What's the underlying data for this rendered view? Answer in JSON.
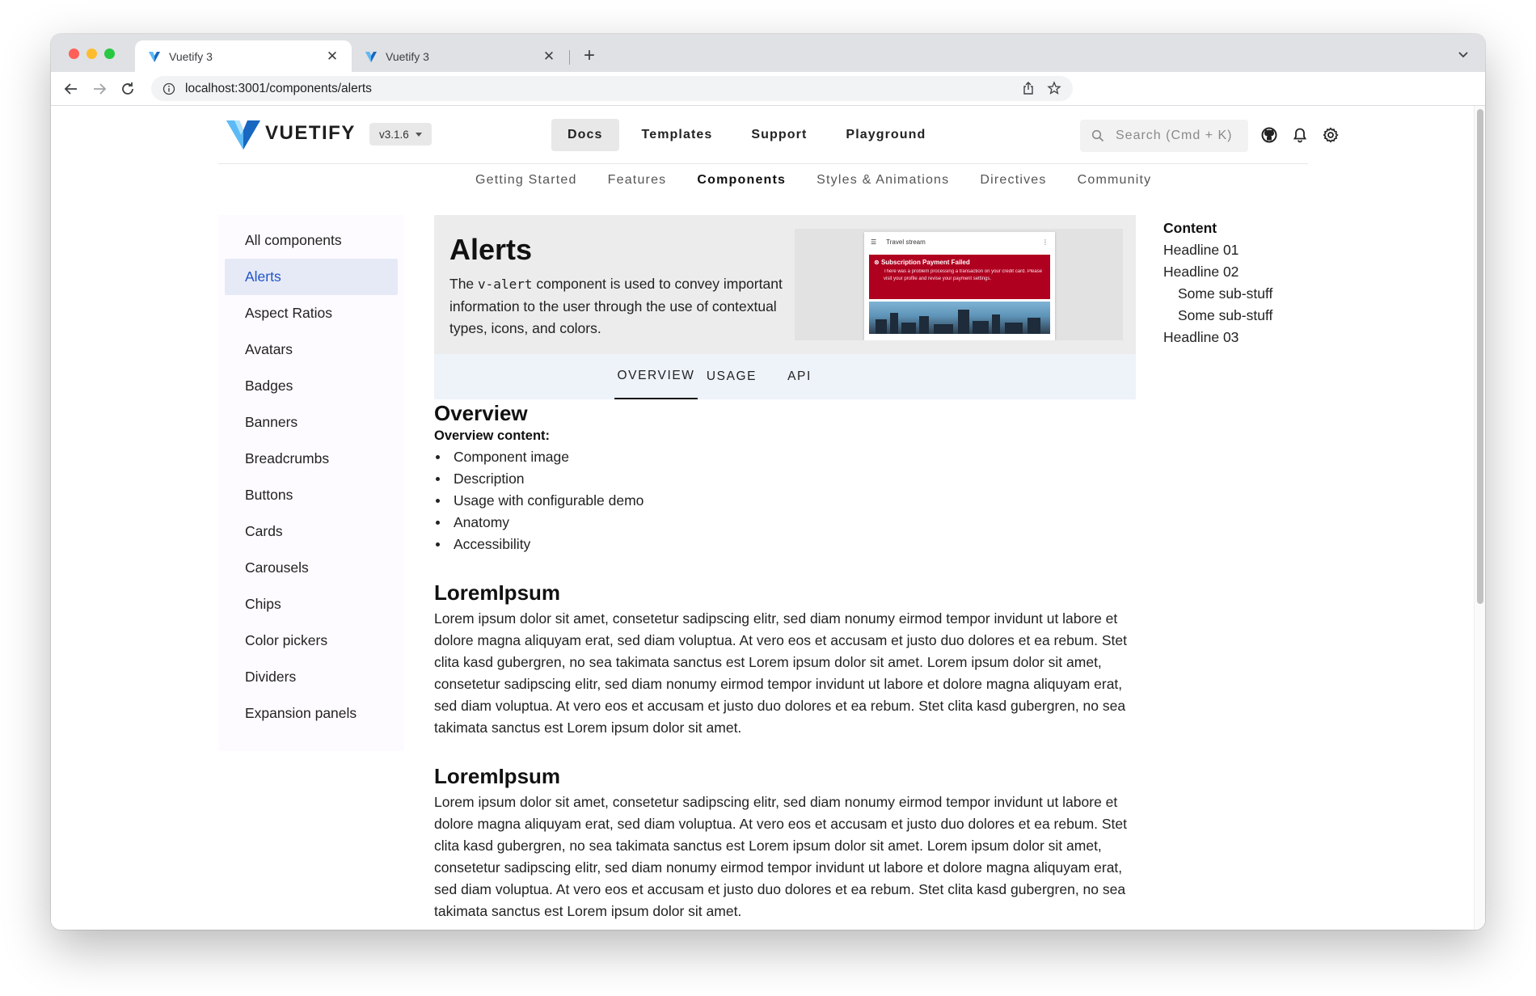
{
  "browser": {
    "tabs": [
      {
        "title": "Vuetify 3",
        "active": true
      },
      {
        "title": "Vuetify 3",
        "active": false
      }
    ],
    "url": "localhost:3001/components/alerts"
  },
  "appbar": {
    "brand": "VUETIFY",
    "version": "v3.1.6",
    "nav": [
      "Docs",
      "Templates",
      "Support",
      "Playground"
    ],
    "active_nav": "Docs",
    "search_placeholder": "Search (Cmd + K)"
  },
  "subnav": {
    "items": [
      "Getting Started",
      "Features",
      "Components",
      "Styles & Animations",
      "Directives",
      "Community"
    ],
    "active": "Components"
  },
  "sidebar": {
    "items": [
      "All components",
      "Alerts",
      "Aspect Ratios",
      "Avatars",
      "Badges",
      "Banners",
      "Breadcrumbs",
      "Buttons",
      "Cards",
      "Carousels",
      "Chips",
      "Color pickers",
      "Dividers",
      "Expansion panels"
    ],
    "active": "Alerts"
  },
  "hero": {
    "title": "Alerts",
    "desc_before": "The ",
    "desc_code": "v-alert",
    "desc_after": " component is used to convey important information to the user through the use of contextual types, icons, and colors.",
    "mock": {
      "bar_title": "Travel stream",
      "alert_title": "Subscription Payment Failed",
      "alert_body": "There was a problem processing a transaction on your credit card. Please visit your profile and revise your payment settings."
    }
  },
  "tabs": {
    "items": [
      "OVERVIEW",
      "USAGE",
      "API"
    ],
    "active": "OVERVIEW"
  },
  "content": {
    "overview_title": "Overview",
    "overview_label": "Overview content:",
    "overview_items": [
      "Component image",
      "Description",
      "Usage with configurable demo",
      "Anatomy",
      "Accessibility"
    ],
    "sections": [
      {
        "title": "LoremIpsum",
        "body": "Lorem ipsum dolor sit amet, consetetur sadipscing elitr, sed diam nonumy eirmod tempor invidunt ut labore et dolore magna aliquyam erat, sed diam voluptua. At vero eos et accusam et justo duo dolores et ea rebum. Stet clita kasd gubergren, no sea takimata sanctus est Lorem ipsum dolor sit amet. Lorem ipsum dolor sit amet, consetetur sadipscing elitr, sed diam nonumy eirmod tempor invidunt ut labore et dolore magna aliquyam erat, sed diam voluptua. At vero eos et accusam et justo duo dolores et ea rebum. Stet clita kasd gubergren, no sea takimata sanctus est Lorem ipsum dolor sit amet."
      },
      {
        "title": "LoremIpsum",
        "body": "Lorem ipsum dolor sit amet, consetetur sadipscing elitr, sed diam nonumy eirmod tempor invidunt ut labore et dolore magna aliquyam erat, sed diam voluptua. At vero eos et accusam et justo duo dolores et ea rebum. Stet clita kasd gubergren, no sea takimata sanctus est Lorem ipsum dolor sit amet. Lorem ipsum dolor sit amet, consetetur sadipscing elitr, sed diam nonumy eirmod tempor invidunt ut labore et dolore magna aliquyam erat, sed diam voluptua. At vero eos et accusam et justo duo dolores et ea rebum. Stet clita kasd gubergren, no sea takimata sanctus est Lorem ipsum dolor sit amet."
      }
    ]
  },
  "toc": {
    "title": "Content",
    "items": [
      {
        "label": "Headline 01",
        "level": 1
      },
      {
        "label": "Headline 02",
        "level": 1
      },
      {
        "label": "Some sub-stuff",
        "level": 2
      },
      {
        "label": "Some sub-stuff",
        "level": 2
      },
      {
        "label": "Headline 03",
        "level": 1
      }
    ]
  },
  "colors": {
    "vuetify_blue": "#1867c0",
    "vuetify_light_blue": "#5cbbf6",
    "sidebar_active_bg": "#e6eaf7",
    "sidebar_active_text": "#2154c7",
    "alert_red": "#b00020"
  },
  "icons": {
    "tab_favicon": "vuetify-logo-icon",
    "back": "arrow-left-icon",
    "forward": "arrow-right-icon",
    "reload": "reload-icon",
    "site_info": "info-icon",
    "share": "share-icon",
    "bookmark": "star-icon",
    "search": "search-icon",
    "github": "github-icon",
    "notifications": "bell-icon",
    "settings": "gear-icon"
  }
}
